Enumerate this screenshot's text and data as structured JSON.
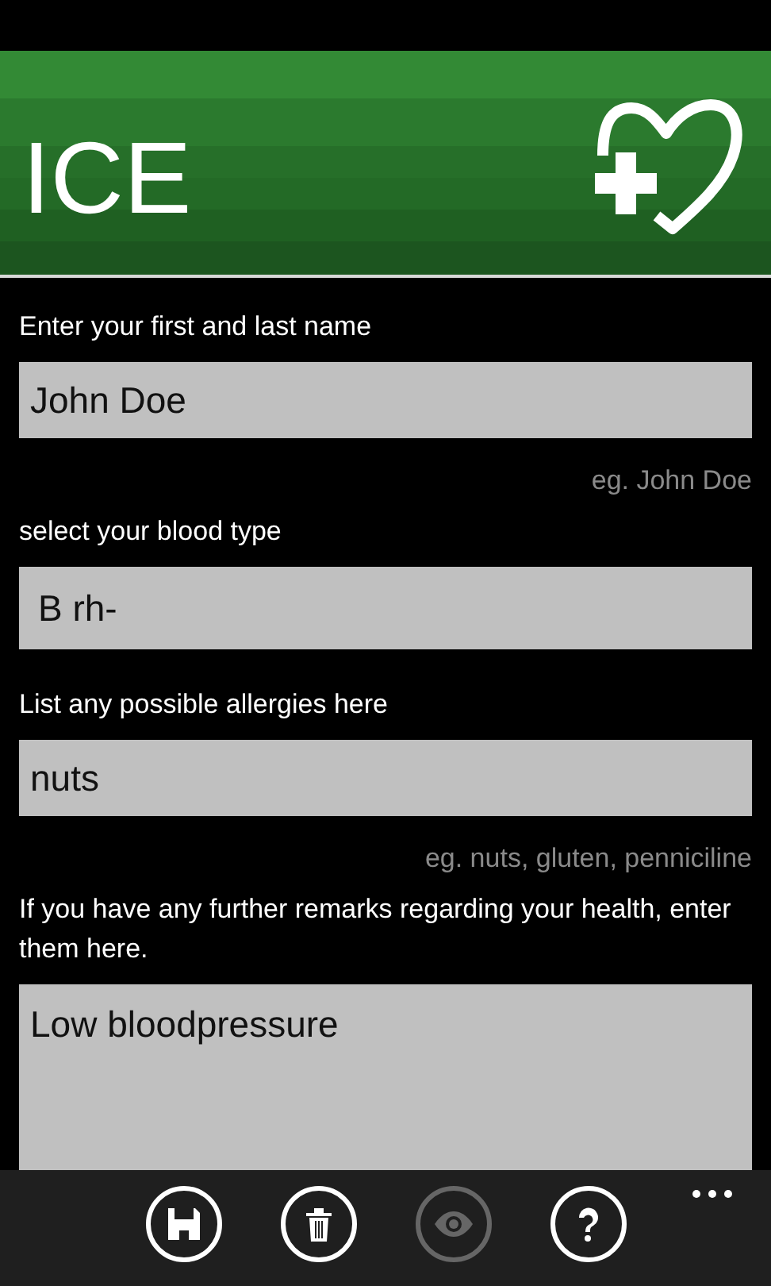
{
  "header": {
    "title": "ICE"
  },
  "form": [
    {
      "kind": "text",
      "label": "Enter your first and last name",
      "value": "John Doe",
      "hint": "eg. John Doe"
    },
    {
      "kind": "picker",
      "label": "select your blood type",
      "value": "B rh-"
    },
    {
      "kind": "text",
      "label": "List any possible allergies here",
      "value": "nuts",
      "hint": "eg. nuts, gluten, penniciline"
    },
    {
      "kind": "textarea",
      "label": "If you have any further remarks regarding your health, enter them here.",
      "value": "Low bloodpressure"
    }
  ],
  "app_bar": {
    "buttons": [
      {
        "kind": "save",
        "disabled": false
      },
      {
        "kind": "delete",
        "disabled": false
      },
      {
        "kind": "view",
        "disabled": true
      },
      {
        "kind": "help",
        "disabled": false
      }
    ]
  }
}
